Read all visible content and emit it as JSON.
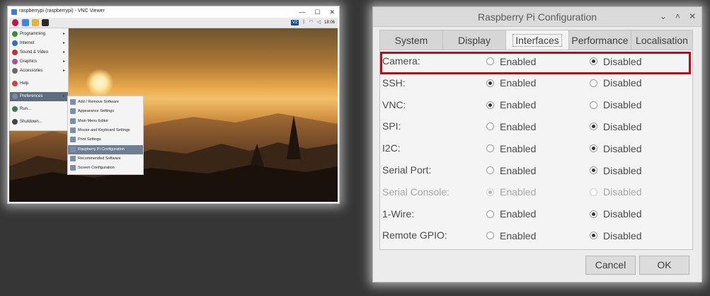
{
  "vnc": {
    "title": "raspberrypi (raspberrypi) - VNC Viewer",
    "controls": [
      "—",
      "☐",
      "✕"
    ],
    "taskbar": {
      "vnc_badge": "V2",
      "clock": "18:06"
    },
    "menu": [
      {
        "label": "Programming",
        "arrow": "▸",
        "color": "#3c8a3c"
      },
      {
        "label": "Internet",
        "arrow": "▸",
        "color": "#2a6fc9"
      },
      {
        "label": "Sound & Video",
        "arrow": "▸",
        "color": "#c03030"
      },
      {
        "label": "Graphics",
        "arrow": "▸",
        "color": "#b04a9a"
      },
      {
        "label": "Accessories",
        "arrow": "▸",
        "color": "#6a6a6a"
      },
      {
        "label": "Help",
        "arrow": "",
        "color": "#d24040"
      },
      {
        "label": "Preferences",
        "arrow": "▸",
        "color": "#7a8aa0"
      },
      {
        "label": "Run...",
        "arrow": "",
        "color": "#3c7a4a"
      },
      {
        "label": "Shutdown...",
        "arrow": "",
        "color": "#444444"
      }
    ],
    "submenu": [
      "Add / Remove Software",
      "Appearance Settings",
      "Main Menu Editor",
      "Mouse and Keyboard Settings",
      "Print Settings",
      "Raspberry Pi Configuration",
      "Recommended Software",
      "Screen Configuration"
    ]
  },
  "dialog": {
    "title": "Raspberry Pi Configuration",
    "controls": [
      "⌄",
      "˄",
      "✕"
    ],
    "tabs": [
      "System",
      "Display",
      "Interfaces",
      "Performance",
      "Localisation"
    ],
    "active_tab": "Interfaces",
    "options": {
      "enabled": "Enabled",
      "disabled": "Disabled"
    },
    "rows": [
      {
        "label": "Camera:",
        "value": "disabled",
        "dim": false
      },
      {
        "label": "SSH:",
        "value": "enabled",
        "dim": false
      },
      {
        "label": "VNC:",
        "value": "enabled",
        "dim": false
      },
      {
        "label": "SPI:",
        "value": "disabled",
        "dim": false
      },
      {
        "label": "I2C:",
        "value": "disabled",
        "dim": false
      },
      {
        "label": "Serial Port:",
        "value": "disabled",
        "dim": false
      },
      {
        "label": "Serial Console:",
        "value": "enabled",
        "dim": true
      },
      {
        "label": "1-Wire:",
        "value": "disabled",
        "dim": false
      },
      {
        "label": "Remote GPIO:",
        "value": "disabled",
        "dim": false
      }
    ],
    "buttons": {
      "cancel": "Cancel",
      "ok": "OK"
    },
    "highlight_color": "#b0121b"
  }
}
